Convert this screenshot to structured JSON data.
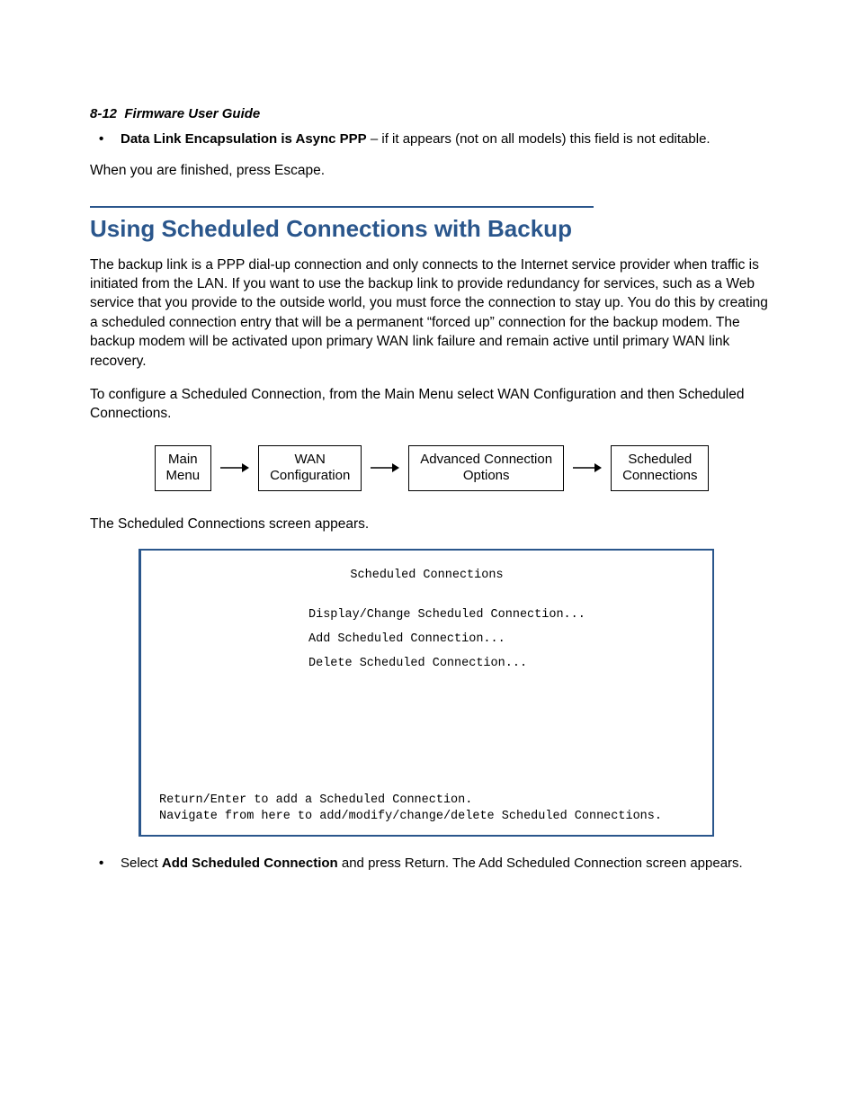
{
  "header": {
    "page_ref": "8-12",
    "doc_title": "Firmware User Guide"
  },
  "intro_bullet": {
    "bold": "Data Link Encapsulation is Async PPP",
    "rest": " – if it appears (not on all models) this field is not editable."
  },
  "intro_after": "When you are finished, press Escape.",
  "section_title": "Using Scheduled Connections with Backup",
  "para1": "The backup link is a PPP dial-up connection and only connects to the Internet service provider when traffic is initiated from the LAN. If you want to use the backup link to provide redundancy for services, such as a Web service that you provide to the outside world, you must force the connection to stay up. You do this by creating a scheduled connection entry that will be a permanent “forced up” connection for the backup modem. The backup modem will be activated upon primary WAN link failure and remain active until primary WAN link recovery.",
  "para2": "To configure a Scheduled Connection, from the Main Menu select WAN Configuration and then Scheduled Connections.",
  "flow": {
    "b1": "Main\nMenu",
    "b2": "WAN\nConfiguration",
    "b3": "Advanced Connection\nOptions",
    "b4": "Scheduled\nConnections"
  },
  "para3": "The Scheduled Connections screen appears.",
  "terminal": {
    "title": "Scheduled Connections",
    "items": [
      "Display/Change Scheduled Connection...",
      "Add Scheduled Connection...",
      "Delete Scheduled Connection..."
    ],
    "footer1": "Return/Enter to add a Scheduled Connection.",
    "footer2": "Navigate from here to add/modify/change/delete Scheduled Connections."
  },
  "final_bullet": {
    "pre": "Select ",
    "bold": "Add Scheduled Connection",
    "post": " and press Return. The Add Scheduled Connection screen appears."
  }
}
